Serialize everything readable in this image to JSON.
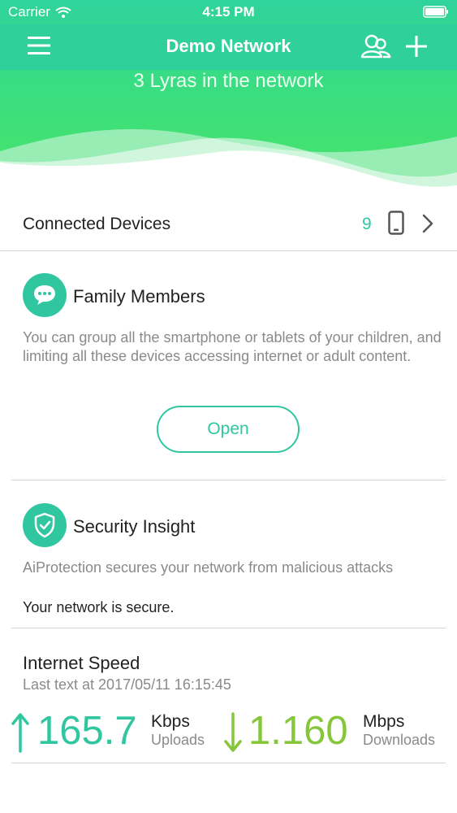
{
  "status_bar": {
    "carrier": "Carrier",
    "time": "4:15 PM"
  },
  "nav": {
    "title": "Demo Network"
  },
  "header": {
    "summary": "3 Lyras in the network"
  },
  "connected_devices": {
    "label": "Connected Devices",
    "count": "9"
  },
  "family_members": {
    "title": "Family Members",
    "description": "You can group all the smartphone or tablets of your children, and limiting all these devices accessing internet or adult content.",
    "button_label": "Open"
  },
  "security_insight": {
    "title": "Security Insight",
    "description": "AiProtection secures your network from malicious attacks",
    "status": "Your network is secure."
  },
  "internet_speed": {
    "title": "Internet Speed",
    "last_test": "Last text at 2017/05/11 16:15:45",
    "upload_value": "165.7",
    "upload_unit": "Kbps",
    "upload_label": "Uploads",
    "download_value": "1.160",
    "download_unit": "Mbps",
    "download_label": "Downloads"
  },
  "colors": {
    "brand_green": "#2fd09a",
    "accent_teal": "#2fc6a0",
    "download_green": "#86c63a",
    "muted_text": "#8a8a8a"
  },
  "icons": [
    "menu-icon",
    "users-icon",
    "add-icon",
    "wifi-icon",
    "battery-icon",
    "phone-icon",
    "chevron-right-icon",
    "chat-icon",
    "shield-icon",
    "arrow-up-icon",
    "arrow-down-icon"
  ]
}
